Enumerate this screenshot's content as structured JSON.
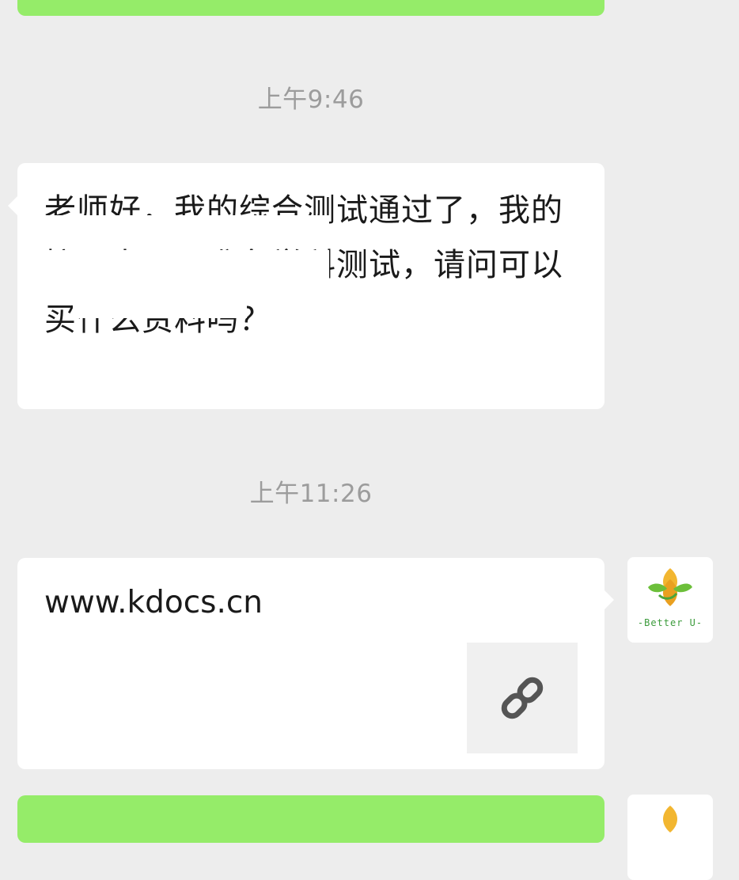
{
  "chat": {
    "timestamps": [
      "上午9:46",
      "上午11:26"
    ],
    "incoming": {
      "text": "老师好，我的综合测试通过了，我的接下来需要准备学科测试，请问可以买什么资料吗？"
    },
    "outgoing_link": {
      "url_text": "www.kdocs.cn",
      "thumb_icon": "link-icon"
    },
    "avatar": {
      "label": "-Better U-",
      "colors": {
        "green": "#6cbf3a",
        "yellow": "#f2b630"
      }
    }
  },
  "colors": {
    "background": "#ededed",
    "sent_bubble": "#95ec69",
    "received_bubble": "#ffffff",
    "timestamp": "#9c9c9c"
  }
}
